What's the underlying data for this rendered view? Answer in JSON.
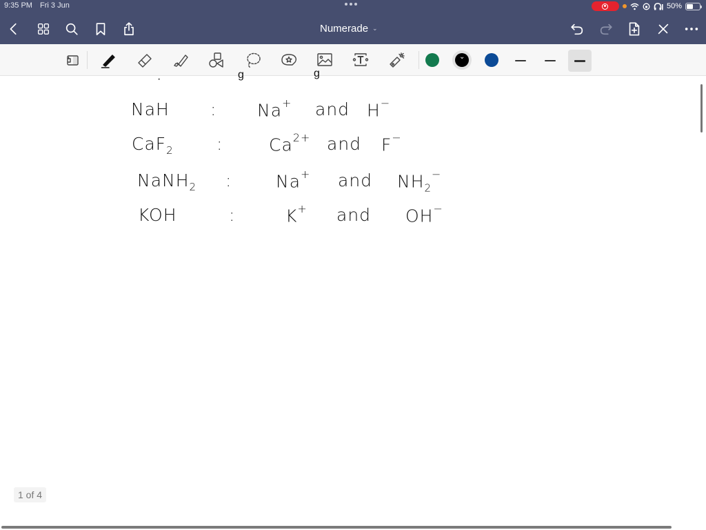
{
  "status_bar": {
    "time": "9:35 PM",
    "date": "Fri 3 Jun",
    "battery": "50%",
    "battery_level": 0.5,
    "recording": true
  },
  "nav": {
    "title": "Numerade",
    "left_icons": [
      "back-icon",
      "thumbnails-icon",
      "search-icon",
      "bookmark-icon",
      "share-icon"
    ],
    "right_icons": [
      "undo-icon",
      "redo-icon",
      "add-page-icon",
      "close-pen-icon",
      "more-icon"
    ]
  },
  "toolbar": {
    "tools": [
      "page-toolbar-icon",
      "pen-icon",
      "eraser-icon",
      "highlighter-icon",
      "shapes-icon",
      "lasso-icon",
      "sticker-icon",
      "image-icon",
      "text-icon",
      "laser-pointer-icon"
    ],
    "active_tool": "pen-icon",
    "colors": [
      "#137a4e",
      "#000000",
      "#0b4a96"
    ],
    "selected_color": "#000000",
    "thickness_options": [
      "thin",
      "medium",
      "thick"
    ],
    "selected_thickness": "thick"
  },
  "note": {
    "rows": [
      {
        "compound": "NaH",
        "compound_sub": "",
        "compound_tail": "",
        "cation": "Na",
        "cation_charge": "+",
        "conj": "and",
        "anion": "H",
        "anion_sub": "",
        "anion_charge": "−"
      },
      {
        "compound": "CaF",
        "compound_sub": "2",
        "compound_tail": "",
        "cation": "Ca",
        "cation_charge": "2+",
        "conj": "and",
        "anion": "F",
        "anion_sub": "",
        "anion_charge": "−"
      },
      {
        "compound": "NaNH",
        "compound_sub": "2",
        "compound_tail": "",
        "cation": "Na",
        "cation_charge": "+",
        "conj": "and",
        "anion": "NH",
        "anion_sub": "2",
        "anion_charge": "−"
      },
      {
        "compound": "KOH",
        "compound_sub": "",
        "compound_tail": "",
        "cation": "K",
        "cation_charge": "+",
        "conj": "and",
        "anion": "OH",
        "anion_sub": "",
        "anion_charge": "−"
      }
    ],
    "separator": ":"
  },
  "page_indicator": "1 of 4"
}
